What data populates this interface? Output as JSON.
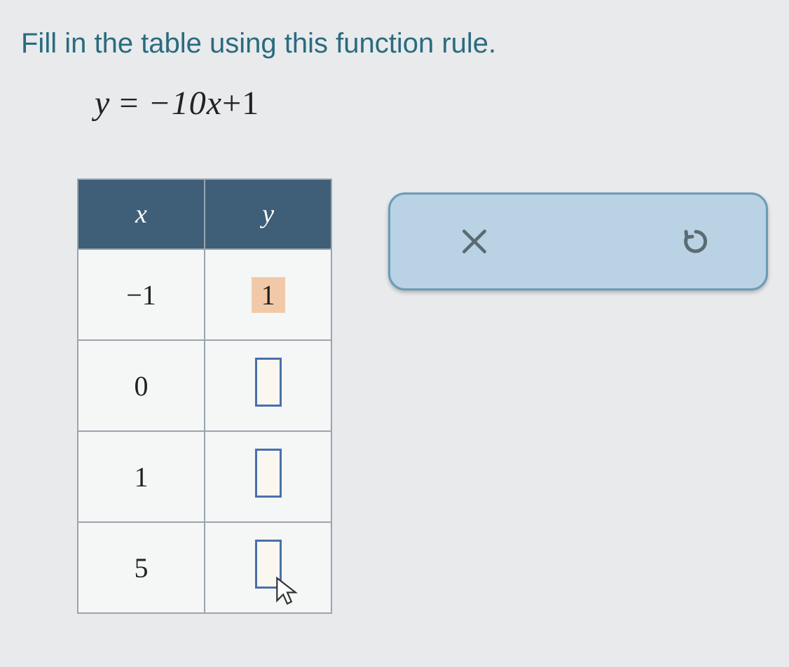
{
  "instruction": "Fill in the table using this function rule.",
  "equation": {
    "lhs": "y",
    "rhs_a": "−10",
    "rhs_var": "x",
    "rhs_b": "+1"
  },
  "table": {
    "headers": {
      "x": "x",
      "y": "y"
    },
    "rows": [
      {
        "x": "−1",
        "y": "1",
        "filled": true
      },
      {
        "x": "0",
        "y": "",
        "filled": false
      },
      {
        "x": "1",
        "y": "",
        "filled": false
      },
      {
        "x": "5",
        "y": "",
        "filled": false
      }
    ]
  },
  "toolbar": {
    "clear_icon": "close-icon",
    "undo_icon": "undo-icon"
  }
}
